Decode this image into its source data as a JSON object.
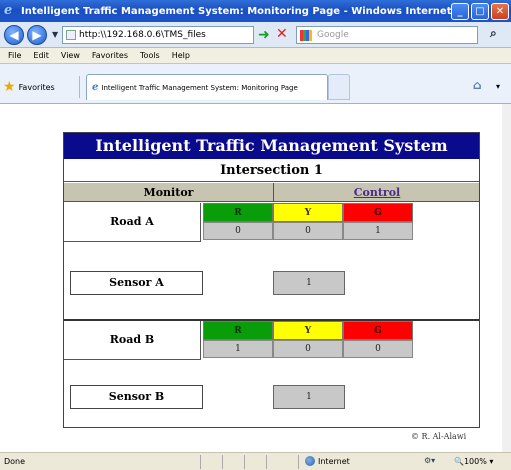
{
  "window": {
    "title": "Intelligent Traffic Management System: Monitoring Page - Windows Internet Explorer",
    "minimize": "_",
    "maximize": "□",
    "close": "✕"
  },
  "address_bar": {
    "url": "http:\\\\192.168.0.6\\TMS_files",
    "search_placeholder": "Google"
  },
  "menu": [
    "File",
    "Edit",
    "View",
    "Favorites",
    "Tools",
    "Help"
  ],
  "favorites_label": "Favorites",
  "tab": {
    "label": "Intelligent Traffic Management System: Monitoring Page"
  },
  "page": {
    "header": "Intelligent Traffic Management System",
    "intersection": "Intersection 1",
    "monitor_label": "Monitor",
    "control_link": "Control",
    "road_a": {
      "label": "Road A",
      "lamps": [
        "R",
        "Y",
        "G"
      ],
      "values": [
        "0",
        "0",
        "1"
      ]
    },
    "sensor_a": {
      "label": "Sensor A",
      "value": "1"
    },
    "road_b": {
      "label": "Road B",
      "lamps": [
        "R",
        "Y",
        "G"
      ],
      "values": [
        "1",
        "0",
        "0"
      ]
    },
    "sensor_b": {
      "label": "Sensor B",
      "value": "1"
    },
    "copyright": "© R. Al-Alawi"
  },
  "status_bar": {
    "status": "Done",
    "zone": "Internet",
    "zoom": "100%"
  },
  "colors": {
    "header_bg": "#0a0a8c",
    "lamp_red_cell": "#0a9d0a",
    "lamp_yellow_cell": "#ffff00",
    "lamp_green_cell": "#ff0000",
    "control_link": "#4b2c8c"
  }
}
